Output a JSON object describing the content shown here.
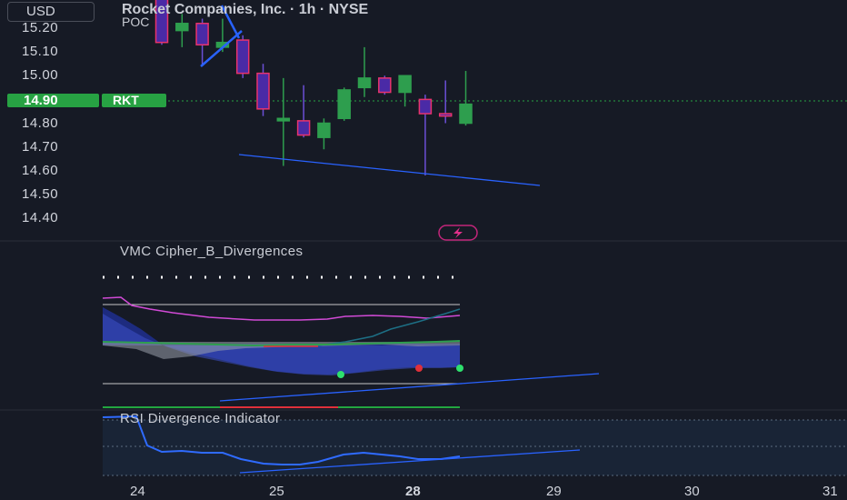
{
  "header": {
    "currency": "USD",
    "symbol_title": "Rocket Companies, Inc. · 1h · NYSE",
    "poc_label": "POC"
  },
  "price_axis": {
    "ticks": [
      "15.20",
      "15.10",
      "15.00",
      "14.90",
      "14.80",
      "14.70",
      "14.60",
      "14.50",
      "14.40"
    ],
    "current_price": "14.90",
    "ticker_badge": "RKT"
  },
  "candles": [
    {
      "o": 15.14,
      "c": 15.42,
      "h": 15.44,
      "l": 15.13,
      "dir": "down"
    },
    {
      "o": 15.19,
      "c": 15.22,
      "h": 15.26,
      "l": 15.12,
      "dir": "up"
    },
    {
      "o": 15.22,
      "c": 15.13,
      "h": 15.24,
      "l": 15.04,
      "dir": "down"
    },
    {
      "o": 15.12,
      "c": 15.14,
      "h": 15.24,
      "l": 15.1,
      "dir": "up"
    },
    {
      "o": 15.15,
      "c": 15.01,
      "h": 15.17,
      "l": 14.99,
      "dir": "down"
    },
    {
      "o": 15.01,
      "c": 14.86,
      "h": 15.05,
      "l": 14.83,
      "dir": "down"
    },
    {
      "o": 14.81,
      "c": 14.82,
      "h": 14.99,
      "l": 14.62,
      "dir": "up"
    },
    {
      "o": 14.81,
      "c": 14.75,
      "h": 14.96,
      "l": 14.74,
      "dir": "down"
    },
    {
      "o": 14.74,
      "c": 14.8,
      "h": 14.82,
      "l": 14.69,
      "dir": "up"
    },
    {
      "o": 14.82,
      "c": 14.94,
      "h": 14.95,
      "l": 14.81,
      "dir": "up"
    },
    {
      "o": 14.95,
      "c": 14.99,
      "h": 15.12,
      "l": 14.91,
      "dir": "up"
    },
    {
      "o": 14.99,
      "c": 14.93,
      "h": 15.0,
      "l": 14.92,
      "dir": "down"
    },
    {
      "o": 14.93,
      "c": 15.0,
      "h": 15.0,
      "l": 14.87,
      "dir": "up"
    },
    {
      "o": 14.9,
      "c": 14.84,
      "h": 14.92,
      "l": 14.58,
      "dir": "down"
    },
    {
      "o": 14.84,
      "c": 14.83,
      "h": 14.98,
      "l": 14.8,
      "dir": "down"
    },
    {
      "o": 14.8,
      "c": 14.88,
      "h": 15.02,
      "l": 14.79,
      "dir": "up"
    }
  ],
  "colors": {
    "background": "#161a25",
    "up_candle": "#2e9e4e",
    "down_candle": "#e8336d",
    "down_body_fill": "#4a2aa6",
    "trendline": "#2962ff",
    "price_badge": "#27a243",
    "vmc_wave": "#1f2f8f",
    "vmc_upper": "#d14ad6",
    "rsi_line": "#2f6bff"
  },
  "indicators": {
    "vmc_title": "VMC Cipher_B_Divergences",
    "rsi_title": "RSI Divergence Indicator"
  },
  "time_axis": {
    "labels": [
      {
        "text": "24",
        "bold": false
      },
      {
        "text": "25",
        "bold": false
      },
      {
        "text": "28",
        "bold": true
      },
      {
        "text": "29",
        "bold": false
      },
      {
        "text": "30",
        "bold": false
      },
      {
        "text": "31",
        "bold": false
      }
    ]
  },
  "icons": {
    "lightning": "lightning-icon"
  }
}
